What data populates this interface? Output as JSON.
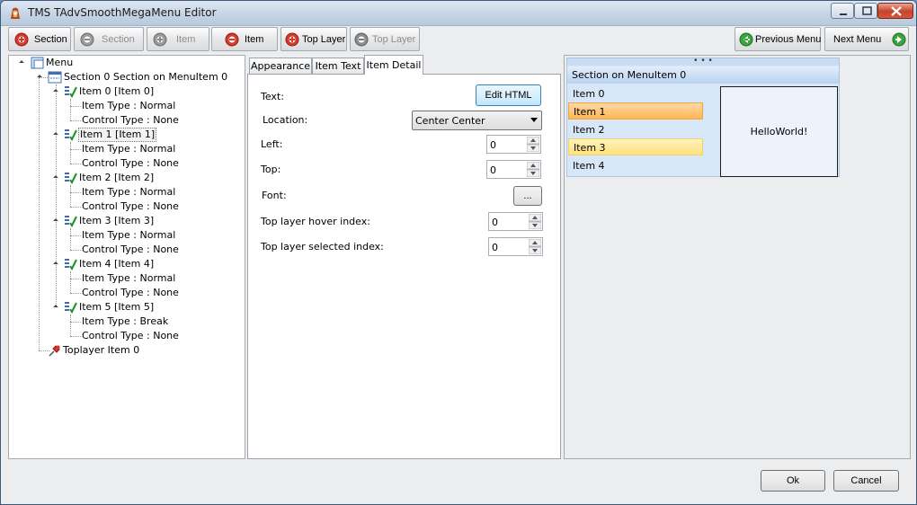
{
  "window": {
    "title": "TMS TAdvSmoothMegaMenu Editor"
  },
  "toolbar": {
    "add_section": "Section",
    "delete_section": "Section",
    "add_item": "Item",
    "delete_item": "Item",
    "add_top_layer": "Top Layer",
    "delete_top_layer": "Top Layer",
    "previous_menu": "Previous Menu",
    "next_menu": "Next Menu"
  },
  "tree": {
    "root": "Menu",
    "section": "Section 0 Section on MenuItem 0",
    "items": [
      {
        "label": "Item 0 [Item 0]",
        "type": "Item Type : Normal",
        "control": "Control Type : None"
      },
      {
        "label": "Item 1 [Item 1]",
        "type": "Item Type : Normal",
        "control": "Control Type : None"
      },
      {
        "label": "Item 2 [Item 2]",
        "type": "Item Type : Normal",
        "control": "Control Type : None"
      },
      {
        "label": "Item 3 [Item 3]",
        "type": "Item Type : Normal",
        "control": "Control Type : None"
      },
      {
        "label": "Item 4 [Item 4]",
        "type": "Item Type : Normal",
        "control": "Control Type : None"
      },
      {
        "label": "Item 5 [Item 5]",
        "type": "Item Type : Break",
        "control": "Control Type : None"
      }
    ],
    "toplayer": "Toplayer Item 0"
  },
  "tabs": {
    "appearance": "Appearance",
    "item_text": "Item Text",
    "item_detail": "Item Detail"
  },
  "detail": {
    "text_label": "Text:",
    "edit_html": "Edit HTML",
    "location_label": "Location:",
    "location_value": "Center Center",
    "left_label": "Left:",
    "left_value": "0",
    "top_label": "Top:",
    "top_value": "0",
    "font_label": "Font:",
    "font_button": "...",
    "hover_label": "Top layer hover index:",
    "hover_value": "0",
    "selected_label": "Top layer selected index:",
    "selected_value": "0"
  },
  "preview": {
    "grip": "• • •",
    "header": "Section on MenuItem 0",
    "items": [
      "Item 0",
      "Item 1",
      "Item 2",
      "Item 3",
      "Item 4"
    ],
    "content": "HelloWorld!",
    "colors": {
      "hover": "#ffb653",
      "selected": "#ffe27a",
      "header": "#b9d3f0"
    }
  },
  "footer": {
    "ok": "Ok",
    "cancel": "Cancel"
  }
}
